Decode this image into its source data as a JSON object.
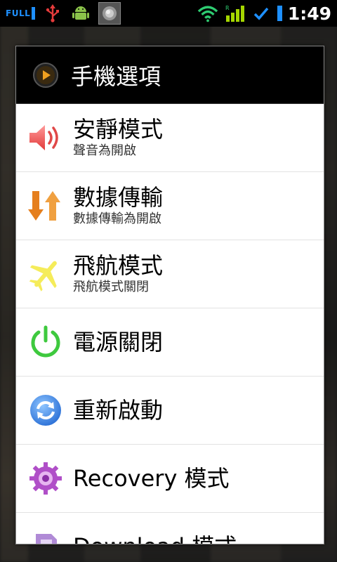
{
  "status_bar": {
    "full_label": "FULL",
    "time": "1:49",
    "icons": [
      "usb-icon",
      "android-debug-icon",
      "media-thumbnail",
      "wifi-icon",
      "signal-icon",
      "sync-check-icon",
      "battery-icon"
    ]
  },
  "dialog": {
    "title": "手機選項",
    "items": [
      {
        "label": "安靜模式",
        "sublabel": "聲音為開啟",
        "icon": "speaker-icon"
      },
      {
        "label": "數據傳輸",
        "sublabel": "數據傳輸為開啟",
        "icon": "data-transfer-icon"
      },
      {
        "label": "飛航模式",
        "sublabel": "飛航模式關閉",
        "icon": "airplane-icon"
      },
      {
        "label": "電源關閉",
        "sublabel": "",
        "icon": "power-icon"
      },
      {
        "label": "重新啟動",
        "sublabel": "",
        "icon": "reboot-icon"
      },
      {
        "label": "Recovery 模式",
        "sublabel": "",
        "icon": "recovery-gear-icon"
      },
      {
        "label": "Download 模式",
        "sublabel": "",
        "icon": "sim-card-icon"
      }
    ]
  },
  "colors": {
    "accent": "#1e90ff",
    "dialog_header": "#000000",
    "dialog_body": "#ffffff"
  }
}
